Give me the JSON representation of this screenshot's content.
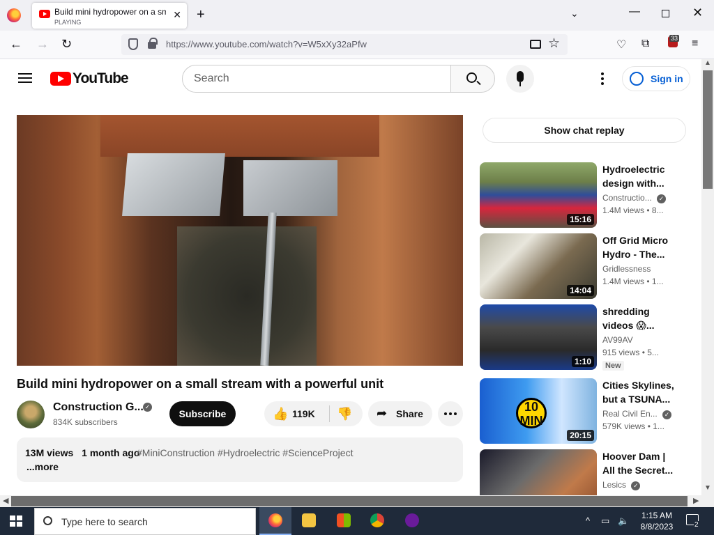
{
  "browser": {
    "tab_title": "Build mini hydropower on a sm",
    "tab_status": "PLAYING",
    "url_host": "https://www.youtube.com",
    "url_path": "/watch?v=W5xXy32aPfw",
    "extension_count": "33"
  },
  "header": {
    "logo_text": "YouTube",
    "search_placeholder": "Search",
    "sign_in_label": "Sign in"
  },
  "video": {
    "title": "Build mini hydropower on a small stream with a powerful unit",
    "channel_name": "Construction G...",
    "subscribers": "834K subscribers",
    "subscribe_label": "Subscribe",
    "likes": "119K",
    "share_label": "Share",
    "views": "13M views",
    "age": "1 month ago",
    "hashtags": "#MiniConstruction #Hydroelectric #ScienceProject",
    "more_label": "...more"
  },
  "sidebar": {
    "chat_replay_label": "Show chat replay",
    "recommendations": [
      {
        "title": "Hydroelectric design with...",
        "channel": "Constructio...",
        "verified": true,
        "views": "1.4M views • 8...",
        "duration": "15:16",
        "badge": ""
      },
      {
        "title": "Off Grid Micro Hydro - The...",
        "channel": "Gridlessness",
        "verified": false,
        "views": "1.4M views • 1...",
        "duration": "14:04",
        "badge": ""
      },
      {
        "title": "shredding videos 😱...",
        "channel": "AV99AV",
        "verified": false,
        "views": "915 views • 5...",
        "duration": "1:10",
        "badge": "New"
      },
      {
        "title": "Cities Skylines, but a TSUNA...",
        "channel": "Real Civil En...",
        "verified": true,
        "views": "579K views • 1...",
        "duration": "20:15",
        "badge": "",
        "thumb_text": "10 MIN"
      },
      {
        "title": "Hoover Dam | All the Secret...",
        "channel": "Lesics",
        "verified": true,
        "views": "",
        "duration": "",
        "badge": ""
      }
    ]
  },
  "taskbar": {
    "search_placeholder": "Type here to search",
    "time": "1:15 AM",
    "date": "8/8/2023",
    "notification_count": "2"
  }
}
